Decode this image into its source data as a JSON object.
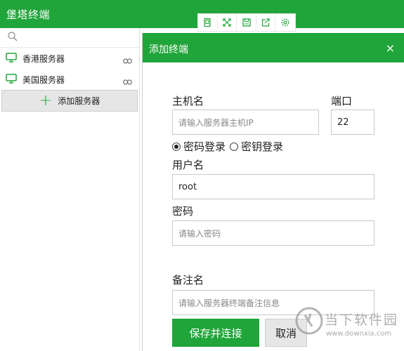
{
  "app": {
    "title": "堡塔终端"
  },
  "toolbar": {
    "buttons": [
      {
        "name": "copy",
        "icon": "window-icon"
      },
      {
        "name": "fullscreen",
        "icon": "expand-icon"
      },
      {
        "name": "save",
        "icon": "save-icon"
      },
      {
        "name": "export",
        "icon": "share-icon"
      },
      {
        "name": "settings",
        "icon": "gear-icon"
      }
    ]
  },
  "sidebar": {
    "servers": [
      {
        "label": "香港服务器"
      },
      {
        "label": "美国服务器"
      }
    ],
    "add_label": "添加服务器"
  },
  "dialog": {
    "title": "添加终端",
    "close": "×",
    "host_label": "主机名",
    "host_placeholder": "请输入服务器主机IP",
    "port_label": "端口",
    "port_value": "22",
    "auth_password": "密码登录",
    "auth_key": "密钥登录",
    "auth_selected": "password",
    "user_label": "用户名",
    "user_value": "root",
    "pass_label": "密码",
    "pass_placeholder": "请输入密码",
    "note_label": "备注名",
    "note_placeholder": "请输入服务器终端备注信息",
    "save_label": "保存并连接",
    "cancel_label": "取消"
  },
  "watermark": {
    "text": "当下软件园",
    "url": "www.downxia.com"
  },
  "colors": {
    "brand": "#20a53a",
    "button_gray": "#e6e6e6"
  }
}
